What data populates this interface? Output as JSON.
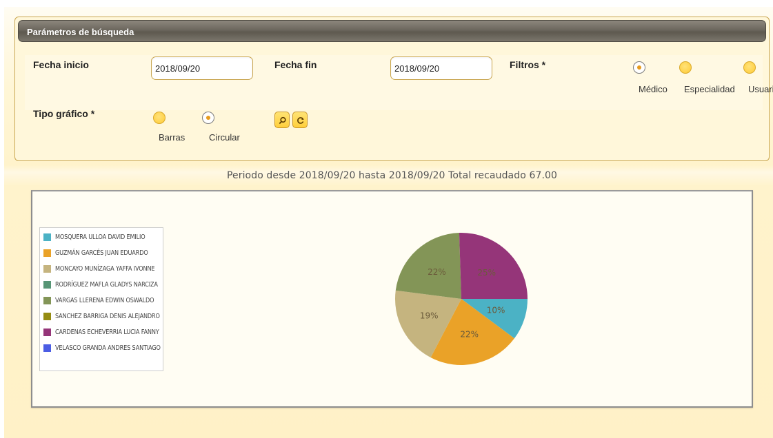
{
  "search_panel": {
    "header_title": "Parámetros de búsqueda",
    "fecha_inicio_label": "Fecha inicio",
    "fecha_inicio_value": "2018/09/20",
    "fecha_fin_label": "Fecha fin",
    "fecha_fin_value": "2018/09/20",
    "filtros_label": "Filtros *",
    "filtros_options": [
      {
        "label": "Médico",
        "selected": true
      },
      {
        "label": "Especialidad",
        "selected": false
      },
      {
        "label": "Usuari",
        "selected": false
      }
    ],
    "tipo_grafico_label": "Tipo gráfico *",
    "tipo_grafico_options": [
      {
        "label": "Barras",
        "selected": false
      },
      {
        "label": "Circular",
        "selected": true
      }
    ],
    "buttons": [
      {
        "name": "search",
        "icon": "search-icon"
      },
      {
        "name": "refresh",
        "icon": "refresh-icon"
      }
    ]
  },
  "report": {
    "title": "Periodo desde 2018/09/20 hasta 2018/09/20 Total recaudado 67.00"
  },
  "colors": {
    "accent": "#ffd24a",
    "header": "#6c675e"
  },
  "chart_data": {
    "type": "pie",
    "legend_position": "left",
    "legend": [
      {
        "name": "MOSQUERA ULLOA DAVID EMILIO",
        "color": "#4bb2c5"
      },
      {
        "name": "GUZMÁN GARCÉS JUAN EDUARDO",
        "color": "#eaa228"
      },
      {
        "name": "MONCAYO MUNÍZAGA YAFFA IVONNE",
        "color": "#c5b47f"
      },
      {
        "name": "RODRÍGUEZ MAFLA GLADYS NARCIZA",
        "color": "#579575"
      },
      {
        "name": "VARGAS LLERENA EDWIN OSWALDO",
        "color": "#839557"
      },
      {
        "name": "SANCHEZ BARRIGA DENIS ALEJANDRO",
        "color": "#958c12"
      },
      {
        "name": "CARDENAS ECHEVERRIA LUCIA FANNY",
        "color": "#953579"
      },
      {
        "name": "VELASCO GRANDA ANDRES SANTIAGO",
        "color": "#4b5de4"
      }
    ],
    "slices": [
      {
        "label": "10%",
        "value": 10,
        "color": "#4bb2c5"
      },
      {
        "label": "22%",
        "value": 22,
        "color": "#eaa228"
      },
      {
        "label": "19%",
        "value": 19,
        "color": "#c5b47f"
      },
      {
        "label": "22%",
        "value": 22,
        "color": "#839557"
      },
      {
        "label": "25%",
        "value": 25,
        "color": "#953579"
      }
    ]
  }
}
